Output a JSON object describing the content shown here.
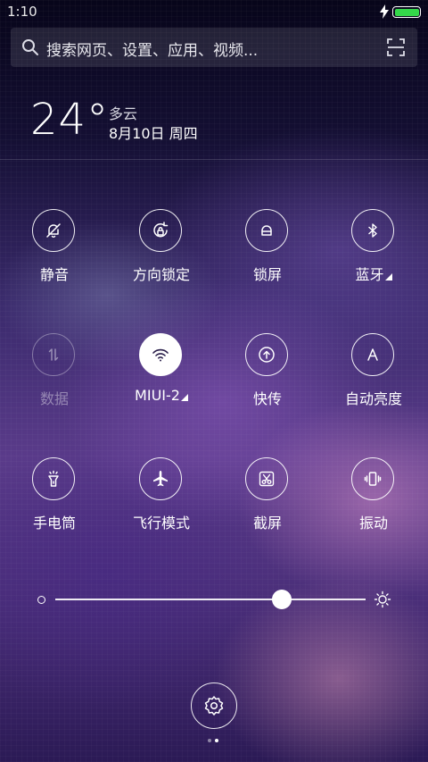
{
  "status_bar": {
    "time": "1:10",
    "battery_level": 1.0,
    "battery_color": "#34d84a",
    "icons": [
      "charging-bolt-icon",
      "battery-icon"
    ]
  },
  "search": {
    "placeholder": "搜索网页、设置、应用、视频...",
    "left_icon": "search-icon",
    "right_icon": "scan-icon"
  },
  "weather": {
    "temperature": "24°",
    "condition": "多云",
    "date": "8月10日 周四"
  },
  "toggles": [
    {
      "id": "mute",
      "label": "静音",
      "icon": "bell-off-icon",
      "state": "off"
    },
    {
      "id": "rotation-lock",
      "label": "方向锁定",
      "icon": "rotation-lock-icon",
      "state": "off"
    },
    {
      "id": "lock-screen",
      "label": "锁屏",
      "icon": "lock-icon",
      "state": "off"
    },
    {
      "id": "bluetooth",
      "label": "蓝牙",
      "icon": "bluetooth-icon",
      "state": "off",
      "has_submenu": true
    },
    {
      "id": "data",
      "label": "数据",
      "icon": "data-arrows-icon",
      "state": "disabled"
    },
    {
      "id": "wifi",
      "label": "MIUI-2",
      "icon": "wifi-icon",
      "state": "on",
      "has_submenu": true
    },
    {
      "id": "quick-share",
      "label": "快传",
      "icon": "upload-icon",
      "state": "off"
    },
    {
      "id": "auto-brightness",
      "label": "自动亮度",
      "icon": "auto-brightness-icon",
      "state": "off"
    },
    {
      "id": "flashlight",
      "label": "手电筒",
      "icon": "flashlight-icon",
      "state": "off"
    },
    {
      "id": "airplane",
      "label": "飞行模式",
      "icon": "airplane-icon",
      "state": "off"
    },
    {
      "id": "screenshot",
      "label": "截屏",
      "icon": "scissors-icon",
      "state": "off"
    },
    {
      "id": "vibrate",
      "label": "振动",
      "icon": "vibrate-icon",
      "state": "off"
    }
  ],
  "brightness": {
    "level": 0.73,
    "low_icon": "brightness-low-icon",
    "high_icon": "brightness-high-icon"
  },
  "settings_button": {
    "icon": "gear-icon"
  },
  "pagination": {
    "total": 2,
    "active": 2
  }
}
